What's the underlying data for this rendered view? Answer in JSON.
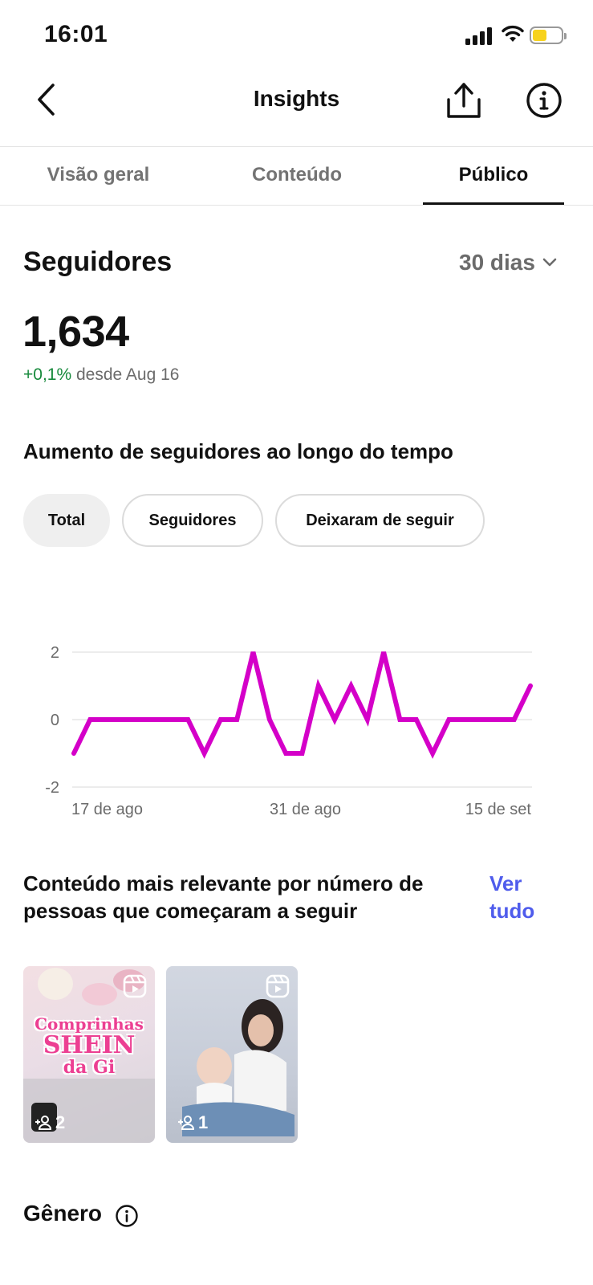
{
  "status_bar": {
    "time": "16:01"
  },
  "header": {
    "title": "Insights"
  },
  "tabs": [
    {
      "label": "Visão geral",
      "active": false
    },
    {
      "label": "Conteúdo",
      "active": false
    },
    {
      "label": "Público",
      "active": true
    }
  ],
  "followers": {
    "title": "Seguidores",
    "range": "30 dias",
    "count": "1,634",
    "change": "+0,1%",
    "change_suffix": "desde Aug 16"
  },
  "growth": {
    "title": "Aumento de seguidores ao longo do tempo",
    "filters": [
      {
        "label": "Total",
        "selected": true
      },
      {
        "label": "Seguidores",
        "selected": false
      },
      {
        "label": "Deixaram de seguir",
        "selected": false
      }
    ]
  },
  "chart_data": {
    "type": "line",
    "title": "",
    "xlabel": "",
    "ylabel": "",
    "x_tick_labels": [
      "17 de ago",
      "31 de ago",
      "15 de set"
    ],
    "y_ticks": [
      2,
      0,
      -2
    ],
    "ylim": [
      -2,
      2
    ],
    "grid": true,
    "series": [
      {
        "color": "#d400c8",
        "values": [
          -1,
          0,
          0,
          0,
          0,
          0,
          0,
          0,
          -1,
          0,
          0,
          2,
          0,
          -1,
          -1,
          1,
          0,
          1,
          0,
          2,
          0,
          0,
          -1,
          0,
          0,
          0,
          0,
          0,
          1
        ]
      }
    ]
  },
  "relevant": {
    "title": "Conteúdo mais relevante por número de pessoas que começaram a seguir",
    "see_all": "Ver tudo",
    "items": [
      {
        "count": "2",
        "overlay_lines": [
          "Comprinhas",
          "SHEIN",
          "da Gi"
        ]
      },
      {
        "count": "1"
      }
    ]
  },
  "gender": {
    "title": "Gênero"
  }
}
